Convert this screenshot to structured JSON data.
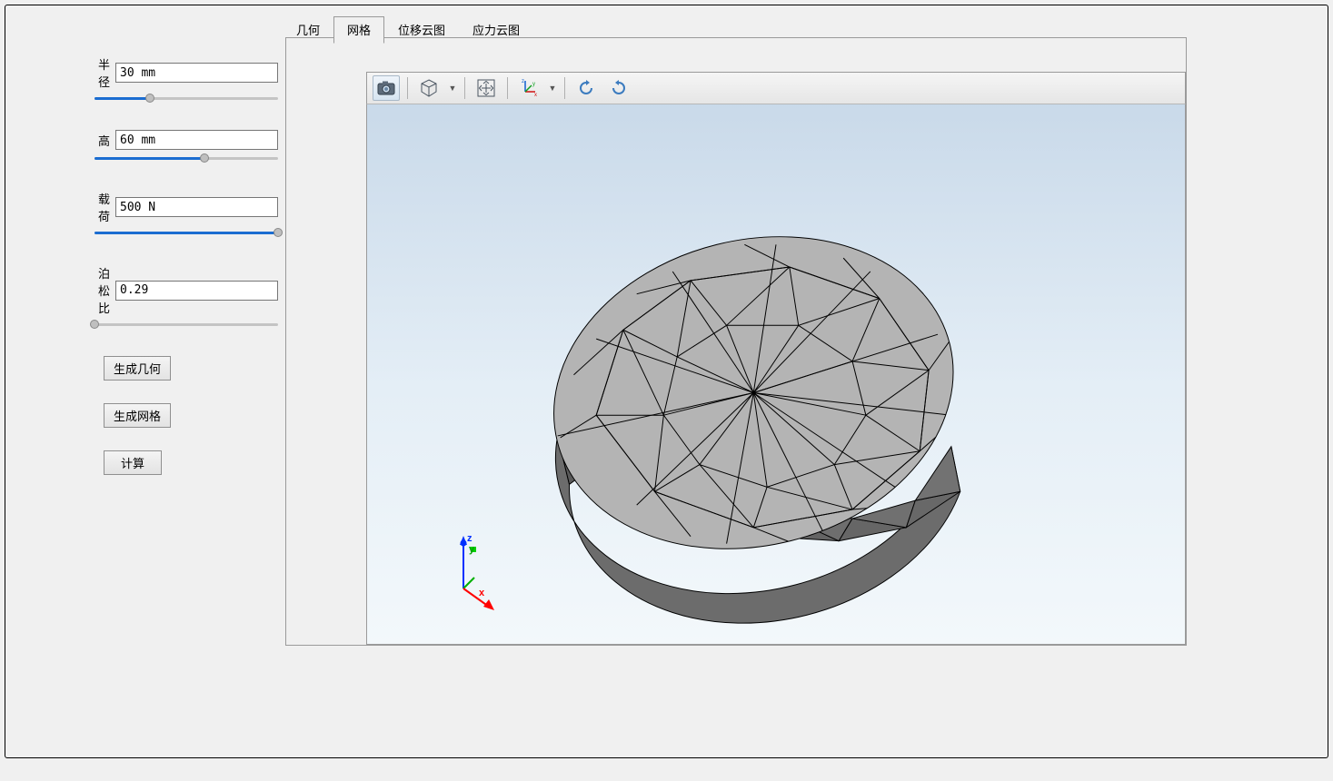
{
  "tabs": {
    "geometry": "几何",
    "mesh": "网格",
    "displacement": "位移云图",
    "stress": "应力云图",
    "active": "mesh"
  },
  "params": {
    "radius": {
      "label": "半径",
      "value": "30 mm",
      "fill_pct": 30
    },
    "height": {
      "label": "高",
      "value": "60 mm",
      "fill_pct": 60
    },
    "load": {
      "label": "载荷",
      "value": "500 N",
      "fill_pct": 100
    },
    "poisson": {
      "label": "泊松比",
      "value": "0.29",
      "fill_pct": 0
    }
  },
  "buttons": {
    "gen_geometry": "生成几何",
    "gen_mesh": "生成网格",
    "compute": "计算"
  },
  "triad": {
    "x": "x",
    "y": "y",
    "z": "z"
  },
  "toolbar_icons": {
    "camera": "camera-icon",
    "cube": "cube-view-icon",
    "fit": "fit-view-icon",
    "axes": "axes-icon",
    "rotate_ccw": "rotate-ccw-icon",
    "rotate_cw": "rotate-cw-icon"
  }
}
